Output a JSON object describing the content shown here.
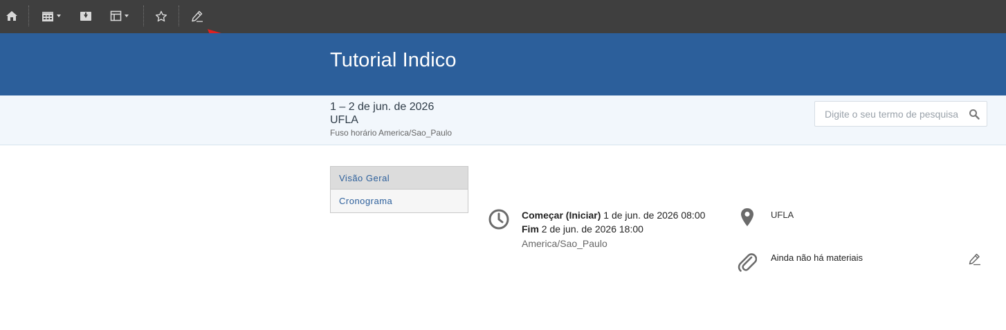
{
  "toolbar": {
    "icons": [
      "home-icon",
      "calendar-icon",
      "download-icon",
      "layout-icon",
      "star-icon",
      "pencil-icon"
    ]
  },
  "header": {
    "title": "Tutorial Indico"
  },
  "info": {
    "dates": "1 – 2 de jun. de 2026",
    "venue": "UFLA",
    "timezone": "Fuso horário America/Sao_Paulo"
  },
  "search": {
    "placeholder": "Digite o seu termo de pesquisa"
  },
  "menu": {
    "items": [
      {
        "label": "Visão Geral"
      },
      {
        "label": "Cronograma"
      }
    ]
  },
  "event": {
    "start_label": "Começar (Iniciar)",
    "start_value": "1 de jun. de 2026 08:00",
    "end_label": "Fim",
    "end_value": "2 de jun. de 2026 18:00",
    "timezone": "America/Sao_Paulo",
    "location": "UFLA",
    "materials": "Ainda não há materiais"
  },
  "colors": {
    "toolbar": "#3f3f3f",
    "banner": "#2c5f9b",
    "infobar": "#f2f7fc",
    "annotation_arrow": "#e02020"
  }
}
